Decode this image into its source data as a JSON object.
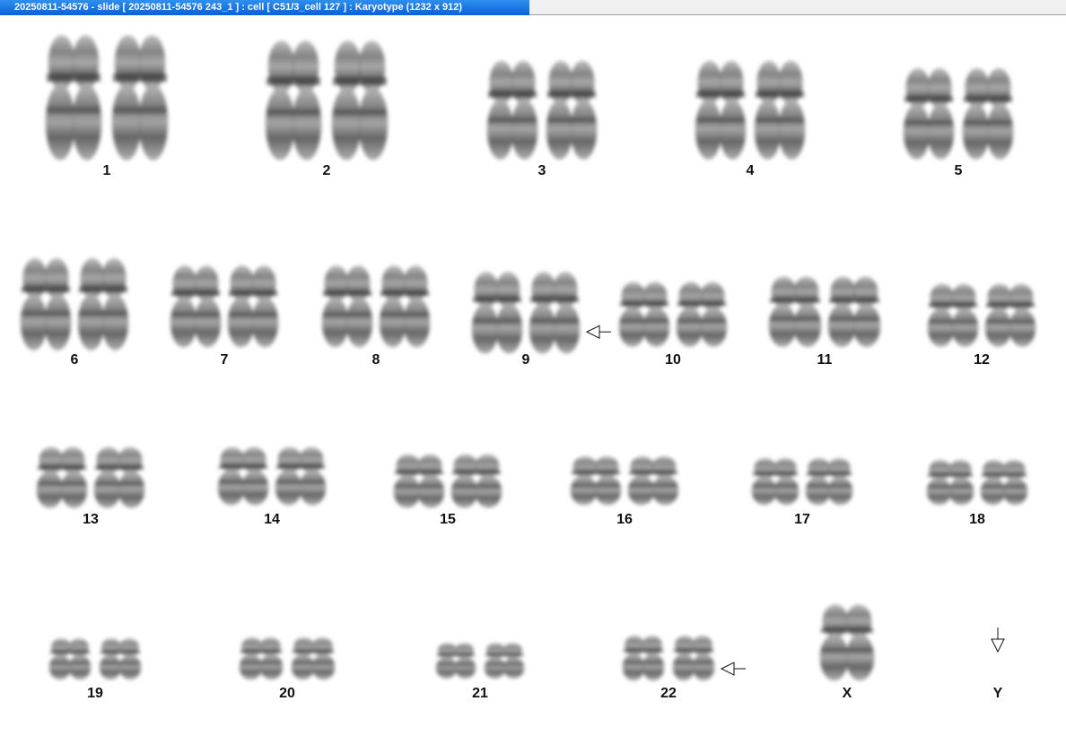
{
  "window": {
    "title": "20250811-54576 - slide [ 20250811-54576 243_1 ] : cell [ C51/3_cell 127 ] : Karyotype  (1232 x 912)"
  },
  "colors": {
    "title_bar": "#1a74e3",
    "chromosome_light": "#c8c8c8",
    "chromosome_dark": "#2a2a2a"
  },
  "karyotype": {
    "chromosomes": [
      {
        "label": "1",
        "count": 2,
        "arrow": ""
      },
      {
        "label": "2",
        "count": 2,
        "arrow": ""
      },
      {
        "label": "3",
        "count": 2,
        "arrow": ""
      },
      {
        "label": "4",
        "count": 2,
        "arrow": ""
      },
      {
        "label": "5",
        "count": 2,
        "arrow": ""
      },
      {
        "label": "6",
        "count": 2,
        "arrow": ""
      },
      {
        "label": "7",
        "count": 2,
        "arrow": ""
      },
      {
        "label": "8",
        "count": 2,
        "arrow": ""
      },
      {
        "label": "9",
        "count": 2,
        "arrow": "left"
      },
      {
        "label": "10",
        "count": 2,
        "arrow": ""
      },
      {
        "label": "11",
        "count": 2,
        "arrow": ""
      },
      {
        "label": "12",
        "count": 2,
        "arrow": ""
      },
      {
        "label": "13",
        "count": 2,
        "arrow": ""
      },
      {
        "label": "14",
        "count": 2,
        "arrow": ""
      },
      {
        "label": "15",
        "count": 2,
        "arrow": ""
      },
      {
        "label": "16",
        "count": 2,
        "arrow": ""
      },
      {
        "label": "17",
        "count": 2,
        "arrow": ""
      },
      {
        "label": "18",
        "count": 2,
        "arrow": ""
      },
      {
        "label": "19",
        "count": 2,
        "arrow": ""
      },
      {
        "label": "20",
        "count": 2,
        "arrow": ""
      },
      {
        "label": "21",
        "count": 2,
        "arrow": ""
      },
      {
        "label": "22",
        "count": 2,
        "arrow": "left"
      },
      {
        "label": "X",
        "count": 1,
        "arrow": ""
      },
      {
        "label": "Y",
        "count": 0,
        "arrow": "down"
      }
    ]
  }
}
